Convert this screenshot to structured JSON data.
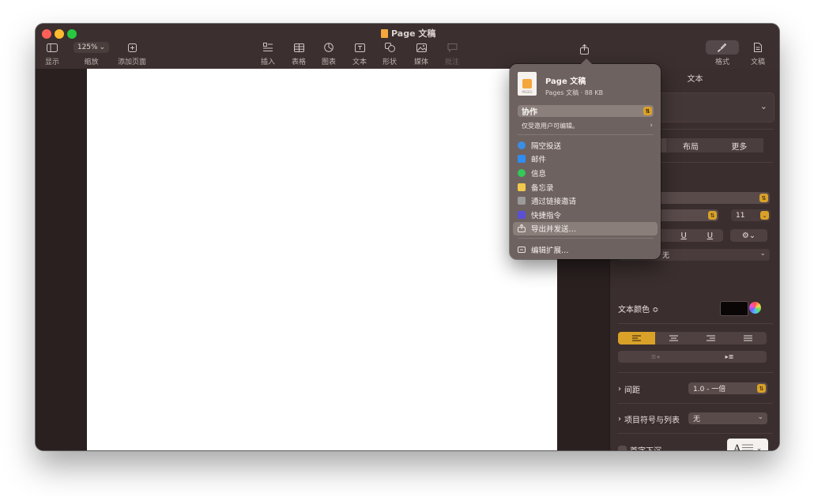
{
  "window": {
    "title": "Page 文稿"
  },
  "toolbar": {
    "left": [
      {
        "label": "显示",
        "icon": "sidebar-icon"
      },
      {
        "label": "缩放",
        "value": "125%",
        "icon": "chevron-down-icon"
      },
      {
        "label": "添加页面",
        "icon": "add-page-icon"
      }
    ],
    "center": [
      {
        "label": "插入",
        "icon": "insert-icon"
      },
      {
        "label": "表格",
        "icon": "table-icon"
      },
      {
        "label": "图表",
        "icon": "chart-icon"
      },
      {
        "label": "文本",
        "icon": "text-box-icon"
      },
      {
        "label": "形状",
        "icon": "shape-icon"
      },
      {
        "label": "媒体",
        "icon": "media-icon"
      },
      {
        "label": "批注",
        "icon": "comment-icon"
      }
    ],
    "share_icon": "share-icon",
    "right": [
      {
        "label": "格式",
        "icon": "paintbrush-icon"
      },
      {
        "label": "文稿",
        "icon": "document-icon"
      }
    ]
  },
  "share_popover": {
    "file_name": "Page 文稿",
    "file_info": "Pages 文稿 · 88 KB",
    "file_icon_tag": "PAGES",
    "collaborate": "协作",
    "permission": "仅受邀用户可编辑。",
    "items": [
      {
        "label": "隔空投送",
        "icon": "airdrop-icon",
        "color": "#3a8ee6"
      },
      {
        "label": "邮件",
        "icon": "mail-icon",
        "color": "#2f8df2"
      },
      {
        "label": "信息",
        "icon": "messages-icon",
        "color": "#34c759"
      },
      {
        "label": "备忘录",
        "icon": "notes-icon",
        "color": "#f2c94c"
      },
      {
        "label": "通过链接邀请",
        "icon": "link-icon",
        "color": "#9a9a9a"
      },
      {
        "label": "快捷指令",
        "icon": "shortcuts-icon",
        "color": "#5b4fd6"
      },
      {
        "label": "导出并发送…",
        "icon": "export-icon",
        "color": "#b7aaa6"
      }
    ],
    "edit_extensions": "编辑扩展…"
  },
  "inspector": {
    "title": "文本",
    "tabs": [
      "",
      "布局",
      "更多"
    ],
    "font_size": "11",
    "underline_1": "U",
    "underline_2": "U",
    "char_style": "无",
    "text_color_label": "文本颜色 ≎",
    "text_color": "#0a0606",
    "spacing_label": "间距",
    "spacing_value": "1.0 - 一倍",
    "bullets_label": "项目符号与列表",
    "bullets_value": "无",
    "dropcap_label": "首字下沉",
    "accent": "#d9a128"
  }
}
